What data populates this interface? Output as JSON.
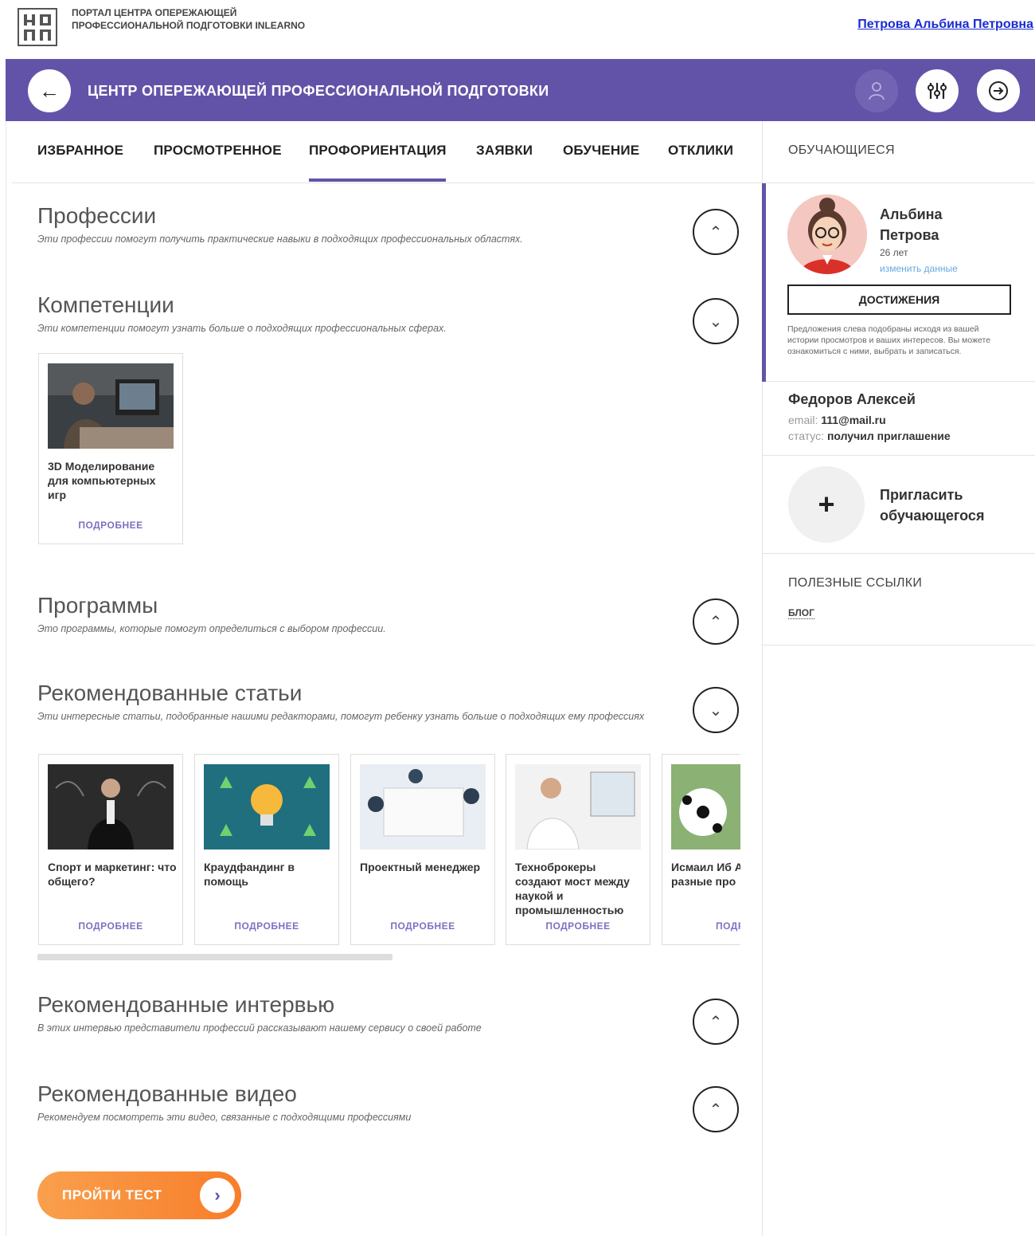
{
  "header": {
    "portal_title": "ПОРТАЛ ЦЕНТРА ОПЕРЕЖАЮЩЕЙ ПРОФЕССИОНАЛЬНОЙ ПОДГОТОВКИ INLEARNO",
    "user_name": "Петрова Альбина Петровна",
    "bar_title": "ЦЕНТР ОПЕРЕЖАЮЩЕЙ ПРОФЕССИОНАЛЬНОЙ ПОДГОТОВКИ",
    "accent_color": "#6353a8",
    "icons": [
      "back-arrow-icon",
      "person-icon",
      "sliders-icon",
      "logout-icon"
    ]
  },
  "tabs": [
    {
      "label": "ИЗБРАННОЕ"
    },
    {
      "label": "ПРОСМОТРЕННОЕ"
    },
    {
      "label": "ПРОФОРИЕНТАЦИЯ",
      "active": true
    },
    {
      "label": "ЗАЯВКИ"
    },
    {
      "label": "ОБУЧЕНИЕ"
    },
    {
      "label": "ОТКЛИКИ"
    }
  ],
  "sections": {
    "professions": {
      "title": "Профессии",
      "desc": "Эти профессии помогут получить практические навыки в подходящих профессиональных областях.",
      "toggle": "up"
    },
    "competences": {
      "title": "Компетенции",
      "desc": "Эти компетенции помогут узнать больше о подходящих профессиональных сферах.",
      "toggle": "down"
    },
    "programs": {
      "title": "Программы",
      "desc": "Это программы, которые помогут определиться с выбором профессии.",
      "toggle": "up"
    },
    "articles": {
      "title": "Рекомендованные статьи",
      "desc": "Эти интересные статьи, подобранные нашими редакторами, помогут ребенку узнать больше о подходящих ему профессиях",
      "toggle": "down"
    },
    "interviews": {
      "title": "Рекомендованные интервью",
      "desc": "В этих интервью представители профессий рассказывают нашему сервису о своей работе",
      "toggle": "up"
    },
    "videos": {
      "title": "Рекомендованные видео",
      "desc": "Рекомендуем посмотреть эти видео, связанные с подходящими профессиями",
      "toggle": "up"
    }
  },
  "competence_cards": [
    {
      "title": "3D Моделирование для компьютерных игр",
      "more": "ПОДРОБНЕЕ"
    }
  ],
  "article_cards": [
    {
      "title": "Спорт и маркетинг: что общего?",
      "more": "ПОДРОБНЕЕ"
    },
    {
      "title": "Краудфандинг в помощь",
      "more": "ПОДРОБНЕЕ"
    },
    {
      "title": "Проектный менеджер",
      "more": "ПОДРОБНЕЕ"
    },
    {
      "title": "Техноброкеры создают мост между наукой и промышленностью",
      "more": "ПОДРОБНЕЕ"
    },
    {
      "title": "Исмаил Иб Агент и ска разные про",
      "more": "ПОДРО"
    }
  ],
  "cta": {
    "label": "ПРОЙТИ ТЕСТ"
  },
  "right_panel": {
    "students_heading": "ОБУЧАЮЩИЕСЯ",
    "student": {
      "name": "Альбина Петрова",
      "age": "26 лет",
      "edit_link": "изменить данные",
      "achievements_button": "ДОСТИЖЕНИЯ",
      "note": "Предложения слева подобраны исходя из вашей истории просмотров и ваших интересов. Вы можете ознакомиться с ними, выбрать и записаться."
    },
    "other_student": {
      "name": "Федоров Алексей",
      "email_label": "email:",
      "email": "111@mail.ru",
      "status_label": "статус:",
      "status": "получил приглашение"
    },
    "invite": {
      "label": "Пригласить обучающегося",
      "icon": "plus-icon"
    },
    "links_heading": "ПОЛЕЗНЫЕ ССЫЛКИ",
    "links": [
      {
        "label": "БЛОГ"
      }
    ]
  }
}
